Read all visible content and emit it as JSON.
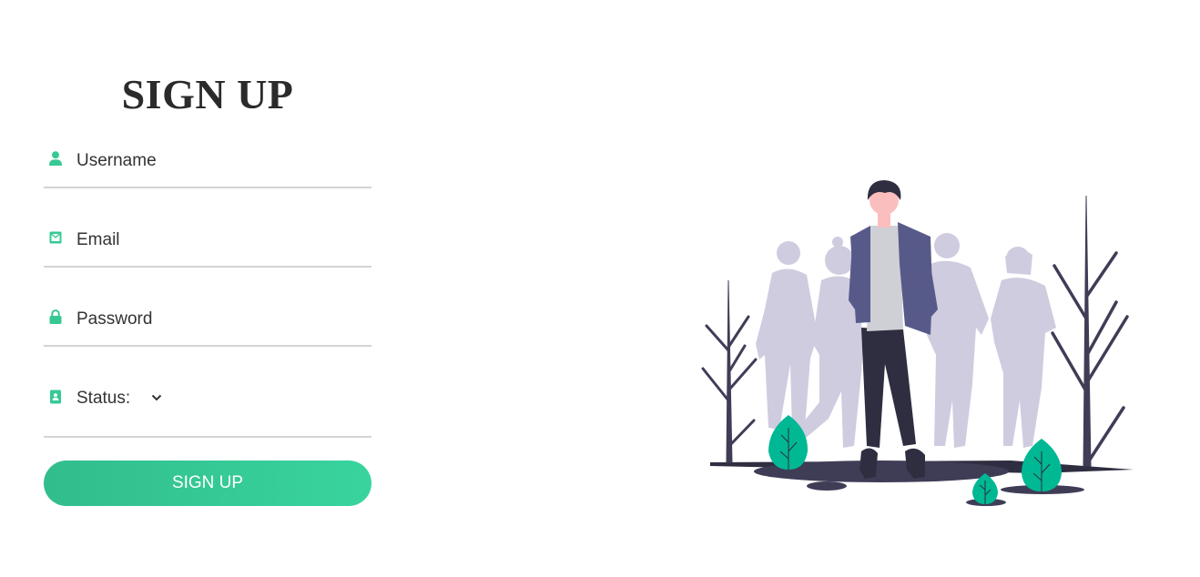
{
  "form": {
    "title": "SIGN UP",
    "username": {
      "placeholder": "Username",
      "icon": "user-icon"
    },
    "email": {
      "placeholder": "Email",
      "icon": "envelope-icon"
    },
    "password": {
      "placeholder": "Password",
      "icon": "lock-icon"
    },
    "status": {
      "label": "Status:",
      "icon": "id-card-icon",
      "selected": ""
    },
    "submit_label": "SIGN UP"
  },
  "illustration": {
    "name": "people-group-illustration"
  },
  "colors": {
    "accent": "#36c994",
    "title": "#2b2b2b",
    "text": "#333333",
    "underline": "#d4d4d4",
    "illustration_silhouette": "#cfcce0",
    "illustration_jacket": "#575a89",
    "illustration_dark": "#2f2e41",
    "illustration_leaf": "#00b894"
  }
}
